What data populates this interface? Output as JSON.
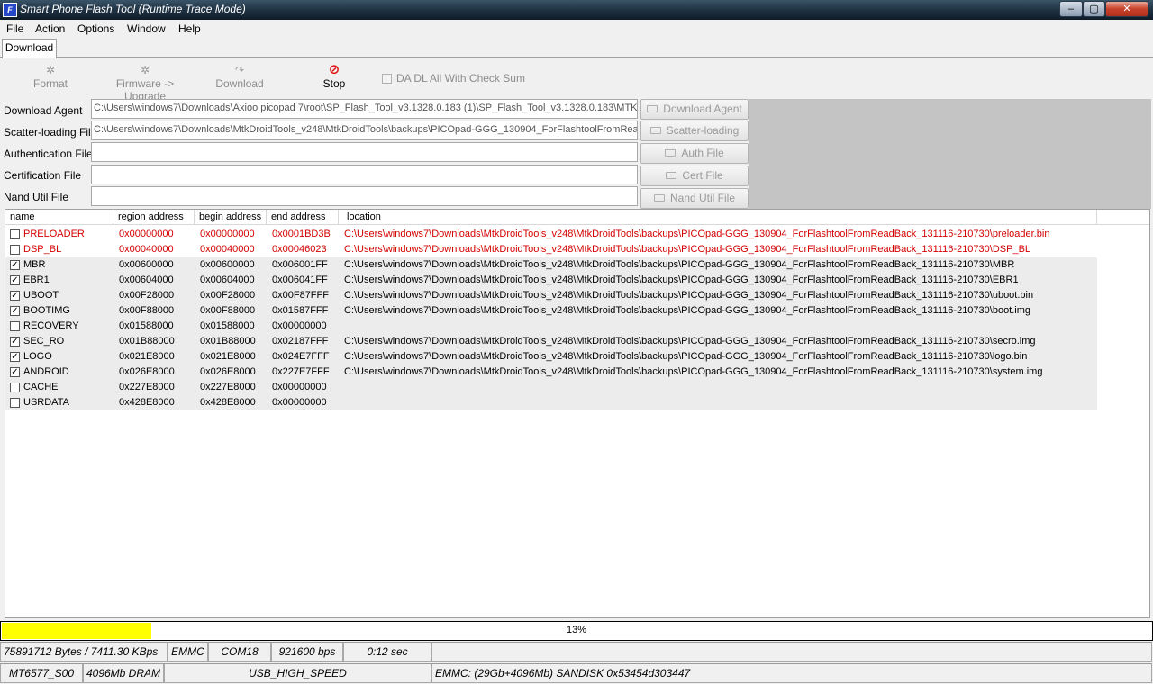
{
  "window": {
    "icon_label": "F",
    "title": "Smart Phone Flash Tool (Runtime Trace Mode)",
    "minimize": "–",
    "maximize": "▢",
    "close": "✕"
  },
  "menu": [
    "File",
    "Action",
    "Options",
    "Window",
    "Help"
  ],
  "tab": "Download",
  "toolbar": {
    "format": "Format",
    "firmware_upgrade": "Firmware -> Upgrade",
    "download": "Download",
    "stop": "Stop",
    "checksum_label": "DA DL All With Check Sum"
  },
  "files": {
    "download_agent": {
      "label": "Download Agent",
      "path": "C:\\Users\\windows7\\Downloads\\Axioo picopad 7\\root\\SP_Flash_Tool_v3.1328.0.183 (1)\\SP_Flash_Tool_v3.1328.0.183\\MTK",
      "button": "Download Agent"
    },
    "scatter": {
      "label": "Scatter-loading File",
      "path": "C:\\Users\\windows7\\Downloads\\MtkDroidTools_v248\\MtkDroidTools\\backups\\PICOpad-GGG_130904_ForFlashtoolFromRead",
      "button": "Scatter-loading"
    },
    "auth": {
      "label": "Authentication File",
      "path": "",
      "button": "Auth File"
    },
    "cert": {
      "label": "Certification File",
      "path": "",
      "button": "Cert File"
    },
    "nand": {
      "label": "Nand Util File",
      "path": "",
      "button": "Nand Util File"
    }
  },
  "table": {
    "headers": {
      "name": "name",
      "region": "region address",
      "begin": "begin address",
      "end": "end address",
      "location": "location"
    },
    "rows": [
      {
        "checked": false,
        "red": true,
        "grey": false,
        "name": "PRELOADER",
        "region": "0x00000000",
        "begin": "0x00000000",
        "end": "0x0001BD3B",
        "location": "C:\\Users\\windows7\\Downloads\\MtkDroidTools_v248\\MtkDroidTools\\backups\\PICOpad-GGG_130904_ForFlashtoolFromReadBack_131116-210730\\preloader.bin"
      },
      {
        "checked": false,
        "red": true,
        "grey": false,
        "name": "DSP_BL",
        "region": "0x00040000",
        "begin": "0x00040000",
        "end": "0x00046023",
        "location": "C:\\Users\\windows7\\Downloads\\MtkDroidTools_v248\\MtkDroidTools\\backups\\PICOpad-GGG_130904_ForFlashtoolFromReadBack_131116-210730\\DSP_BL"
      },
      {
        "checked": true,
        "red": false,
        "grey": true,
        "name": "MBR",
        "region": "0x00600000",
        "begin": "0x00600000",
        "end": "0x006001FF",
        "location": "C:\\Users\\windows7\\Downloads\\MtkDroidTools_v248\\MtkDroidTools\\backups\\PICOpad-GGG_130904_ForFlashtoolFromReadBack_131116-210730\\MBR"
      },
      {
        "checked": true,
        "red": false,
        "grey": true,
        "name": "EBR1",
        "region": "0x00604000",
        "begin": "0x00604000",
        "end": "0x006041FF",
        "location": "C:\\Users\\windows7\\Downloads\\MtkDroidTools_v248\\MtkDroidTools\\backups\\PICOpad-GGG_130904_ForFlashtoolFromReadBack_131116-210730\\EBR1"
      },
      {
        "checked": true,
        "red": false,
        "grey": true,
        "name": "UBOOT",
        "region": "0x00F28000",
        "begin": "0x00F28000",
        "end": "0x00F87FFF",
        "location": "C:\\Users\\windows7\\Downloads\\MtkDroidTools_v248\\MtkDroidTools\\backups\\PICOpad-GGG_130904_ForFlashtoolFromReadBack_131116-210730\\uboot.bin"
      },
      {
        "checked": true,
        "red": false,
        "grey": true,
        "name": "BOOTIMG",
        "region": "0x00F88000",
        "begin": "0x00F88000",
        "end": "0x01587FFF",
        "location": "C:\\Users\\windows7\\Downloads\\MtkDroidTools_v248\\MtkDroidTools\\backups\\PICOpad-GGG_130904_ForFlashtoolFromReadBack_131116-210730\\boot.img"
      },
      {
        "checked": false,
        "red": false,
        "grey": true,
        "name": "RECOVERY",
        "region": "0x01588000",
        "begin": "0x01588000",
        "end": "0x00000000",
        "location": ""
      },
      {
        "checked": true,
        "red": false,
        "grey": true,
        "name": "SEC_RO",
        "region": "0x01B88000",
        "begin": "0x01B88000",
        "end": "0x02187FFF",
        "location": "C:\\Users\\windows7\\Downloads\\MtkDroidTools_v248\\MtkDroidTools\\backups\\PICOpad-GGG_130904_ForFlashtoolFromReadBack_131116-210730\\secro.img"
      },
      {
        "checked": true,
        "red": false,
        "grey": true,
        "name": "LOGO",
        "region": "0x021E8000",
        "begin": "0x021E8000",
        "end": "0x024E7FFF",
        "location": "C:\\Users\\windows7\\Downloads\\MtkDroidTools_v248\\MtkDroidTools\\backups\\PICOpad-GGG_130904_ForFlashtoolFromReadBack_131116-210730\\logo.bin"
      },
      {
        "checked": true,
        "red": false,
        "grey": true,
        "name": "ANDROID",
        "region": "0x026E8000",
        "begin": "0x026E8000",
        "end": "0x227E7FFF",
        "location": "C:\\Users\\windows7\\Downloads\\MtkDroidTools_v248\\MtkDroidTools\\backups\\PICOpad-GGG_130904_ForFlashtoolFromReadBack_131116-210730\\system.img"
      },
      {
        "checked": false,
        "red": false,
        "grey": true,
        "name": "CACHE",
        "region": "0x227E8000",
        "begin": "0x227E8000",
        "end": "0x00000000",
        "location": ""
      },
      {
        "checked": false,
        "red": false,
        "grey": true,
        "name": "USRDATA",
        "region": "0x428E8000",
        "begin": "0x428E8000",
        "end": "0x00000000",
        "location": ""
      }
    ]
  },
  "progress": {
    "percent": 13,
    "label": "13%",
    "color": "#ffff00"
  },
  "status1": {
    "bytes": "75891712 Bytes / 7411.30 KBps",
    "storage": "EMMC",
    "port": "COM18",
    "baud": "921600 bps",
    "time": "0:12 sec",
    "extra": ""
  },
  "status2": {
    "chip": "MT6577_S00",
    "dram": "4096Mb DRAM",
    "usb": "USB_HIGH_SPEED",
    "emmc": "EMMC: (29Gb+4096Mb) SANDISK 0x53454d303447"
  },
  "colors": {
    "red_text": "#d40000",
    "title_bar": "#1d2f40"
  }
}
